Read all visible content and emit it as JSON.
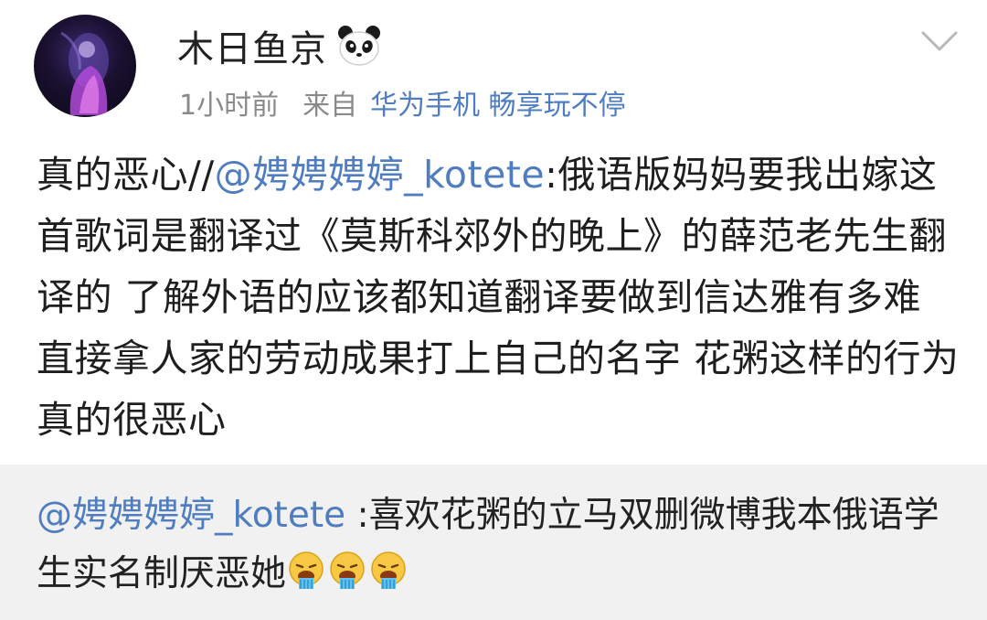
{
  "post": {
    "username": "木日鱼京",
    "user_badge_icon": "panda-icon",
    "more_icon": "chevron-down-icon",
    "time": "1小时前",
    "from_label": "来自",
    "device": "华为手机 畅享玩不停",
    "body_prefix": "真的恶心//",
    "body_mention": "@娉娉娉婷_kotete",
    "body_rest": ":俄语版妈妈要我出嫁这首歌词是翻译过《莫斯科郊外的晚上》的薛范老先生翻译的 了解外语的应该都知道翻译要做到信达雅有多难 直接拿人家的劳动成果打上自己的名字 花粥这样的行为真的很恶心"
  },
  "repost": {
    "mention": "@娉娉娉婷_kotete",
    "text": " :喜欢花粥的立马双删微博我本俄语学生实名制厌恶她",
    "emoji_icon": "vomit-emoji-icon",
    "emoji_count": 3
  },
  "colors": {
    "link": "#4f7dbf",
    "meta": "#8a8a8a",
    "repost_bg": "#f1f1f1"
  }
}
